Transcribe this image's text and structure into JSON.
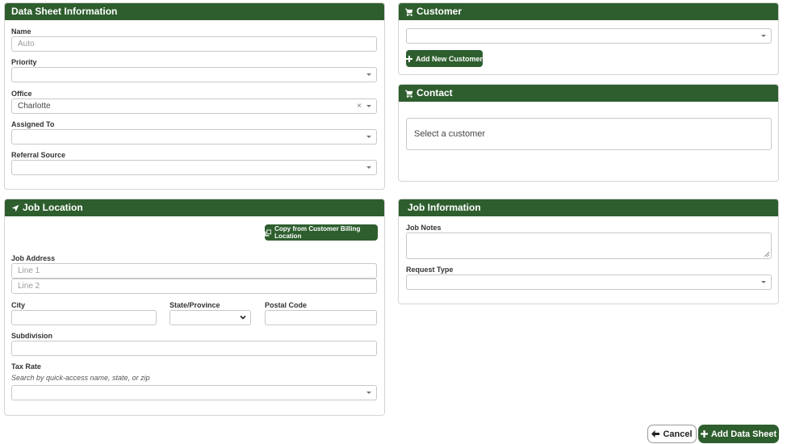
{
  "data_sheet": {
    "title": "Data Sheet Information",
    "name_label": "Name",
    "name_placeholder": "Auto",
    "priority_label": "Priority",
    "office_label": "Office",
    "office_value": "Charlotte",
    "office_clear": "×",
    "assigned_label": "Assigned To",
    "referral_label": "Referral Source"
  },
  "customer": {
    "title": "Customer",
    "add_button": "Add New Customer"
  },
  "contact": {
    "title": "Contact",
    "placeholder": "Select a customer"
  },
  "job_location": {
    "title": "Job Location",
    "copy_button": "Copy from Customer Billing Location",
    "address_label": "Job Address",
    "line1_placeholder": "Line 1",
    "line2_placeholder": "Line 2",
    "city_label": "City",
    "state_label": "State/Province",
    "postal_label": "Postal Code",
    "subdivision_label": "Subdivision",
    "tax_label": "Tax Rate",
    "tax_hint": "Search by quick-access name, state, or zip"
  },
  "job_info": {
    "title": "Job Information",
    "notes_label": "Job Notes",
    "request_label": "Request Type"
  },
  "footer": {
    "cancel": "Cancel",
    "add": "Add Data Sheet"
  },
  "colors": {
    "header_green": "#2e5e2e",
    "border": "#d4d4d4"
  }
}
